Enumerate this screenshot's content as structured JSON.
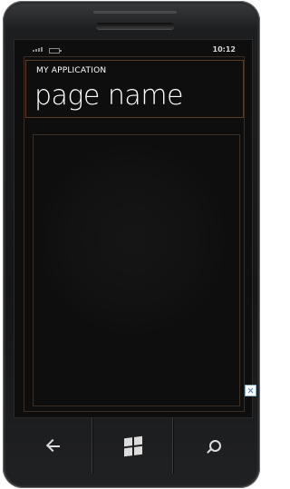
{
  "status_bar": {
    "time": "10:12",
    "signal_icon": "signal-icon",
    "battery_icon": "battery-icon"
  },
  "header": {
    "application_title": "MY APPLICATION",
    "page_title": "page name"
  },
  "nav_bar": {
    "buttons": [
      {
        "name": "back",
        "icon": "back-arrow-icon"
      },
      {
        "name": "start",
        "icon": "windows-logo-icon"
      },
      {
        "name": "search",
        "icon": "search-icon"
      }
    ]
  },
  "colors": {
    "screen_background": "#0e0e0f",
    "text": "#ffffff",
    "panel_border": "#5a3b24",
    "device_frame": "#1d1e20"
  }
}
